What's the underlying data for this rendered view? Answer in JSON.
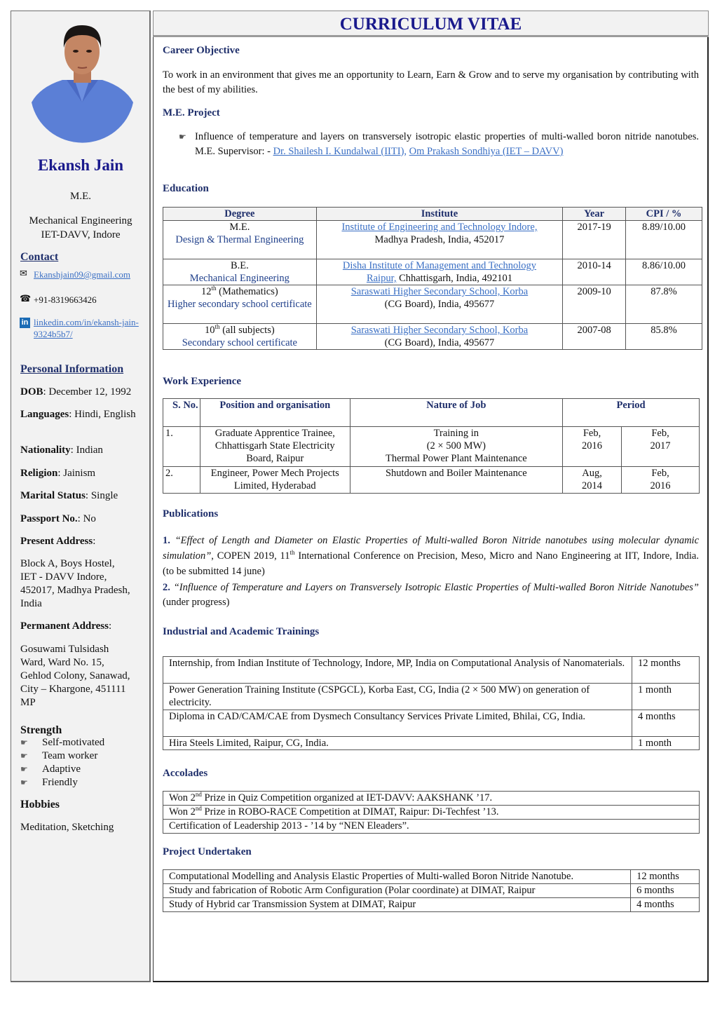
{
  "sidebar": {
    "name": "Ekansh Jain",
    "degree": "M.E.",
    "department_line1": "Mechanical Engineering",
    "department_line2": "IET-DAVV, Indore",
    "contact_heading": "Contact",
    "email": "Ekanshjain09@gmail.com",
    "phone": "+91-8319663426",
    "linkedin_line1": "linkedin.com/in/ekansh-jain-",
    "linkedin_line2": "9324b5b7/",
    "icons": {
      "email": "envelope-icon",
      "phone": "telephone-icon",
      "linkedin": "linkedin-icon",
      "bullet": "pointing-hand-icon"
    },
    "personal_heading": "Personal Information",
    "dob_label": "DOB",
    "dob_value": ": December 12, 1992",
    "languages_label": "Languages",
    "languages_value": ": Hindi, English",
    "nationality_label": "Nationality",
    "nationality_value": ": Indian",
    "religion_label": "Religion",
    "religion_value": ": Jainism",
    "marital_label": "Marital Status",
    "marital_value": ": Single",
    "passport_label": "Passport No.",
    "passport_value": ": No",
    "present_address_label": "Present Address",
    "present_address": [
      "Block A, Boys Hostel,",
      "IET - DAVV Indore,",
      "452017, Madhya Pradesh,",
      "India"
    ],
    "permanent_address_label": "Permanent Address",
    "permanent_address": [
      "Gosuwami Tulsidash",
      "Ward, Ward No. 15,",
      "Gehlod Colony, Sanawad,",
      "City – Khargone, 451111",
      "MP"
    ],
    "strength_heading": "Strength",
    "strengths": [
      "Self-motivated",
      "Team worker",
      "Adaptive",
      "Friendly"
    ],
    "hobbies_heading": "Hobbies",
    "hobbies": "Meditation, Sketching"
  },
  "main": {
    "title": "CURRICULUM VITAE",
    "career_heading": "Career Objective",
    "career_text": "To work in an environment that gives me an opportunity to Learn, Earn & Grow and to serve my organisation by contributing with the best of my abilities.",
    "project_heading": "M.E. Project",
    "project_text": "Influence of temperature and layers on transversely isotropic elastic properties of multi-walled boron nitride nanotubes. M.E. Supervisor: - ",
    "supervisor1": "Dr. Shailesh I. Kundalwal (IITI),",
    "supervisor2": "Om Prakash Sondhiya (IET – DAVV)",
    "education_heading": "Education",
    "education_headers": [
      "Degree",
      "Institute",
      "Year",
      "CPI / %"
    ],
    "education": [
      {
        "degree": "M.E.",
        "degree_sub": "Design & Thermal Engineering",
        "institute_link": "Institute of Engineering and Technology Indore,",
        "institute_rest": "Madhya Pradesh, India, 452017",
        "year": "2017-19",
        "score": "8.89/10.00"
      },
      {
        "degree": "B.E.",
        "degree_sub": "Mechanical Engineering",
        "institute_link": "Disha Institute of Management and Technology",
        "institute_link2": "Raipur,",
        "institute_rest": " Chhattisgarh, India, 492101",
        "year": "2010-14",
        "score": "8.86/10.00"
      },
      {
        "degree_num": "12",
        "degree_sup": "th",
        "degree_tail": " (Mathematics)",
        "degree_sub": "Higher secondary school certificate",
        "institute_link": "Saraswati Higher Secondary School, Korba",
        "institute_rest": "(CG Board), India, 495677",
        "year": "2009-10",
        "score": "87.8%"
      },
      {
        "degree_num": "10",
        "degree_sup": "th",
        "degree_tail": " (all subjects)",
        "degree_sub": "Secondary school certificate",
        "institute_link": "Saraswati Higher Secondary School, Korba",
        "institute_rest": "(CG Board), India, 495677",
        "year": "2007-08",
        "score": "85.8%"
      }
    ],
    "work_heading": "Work Experience",
    "work_headers": [
      "S. No.",
      "Position and organisation",
      "Nature of Job",
      "Period"
    ],
    "work": [
      {
        "sno": "1.",
        "position": "Graduate Apprentice Trainee, Chhattisgarh State Electricity Board, Raipur",
        "nature": [
          "Training in",
          "(2 × 500 MW)",
          "Thermal Power Plant Maintenance"
        ],
        "from": "Feb, 2016",
        "to": "Feb, 2017"
      },
      {
        "sno": "2.",
        "position": "Engineer, Power Mech Projects Limited, Hyderabad",
        "nature": [
          "Shutdown and Boiler Maintenance"
        ],
        "from": "Aug, 2014",
        "to": "Feb, 2016"
      }
    ],
    "publications_heading": "Publications",
    "publications": [
      {
        "num": "1.",
        "title": "“Effect of Length and Diameter on Elastic Properties of Multi-walled Boron Nitride nanotubes using molecular dynamic simulation”",
        "rest_a": ", COPEN 2019, 11",
        "rest_sup": "th",
        "rest_b": " International Conference on Precision, Meso, Micro and Nano Engineering at IIT, Indore, India. (to be submitted 14 june)"
      },
      {
        "num": "2.",
        "title": "“Influence of Temperature and Layers on Transversely Isotropic Elastic Properties of Multi-walled Boron Nitride Nanotubes”",
        "rest_a": " (under progress)"
      }
    ],
    "trainings_heading": "Industrial and Academic Trainings",
    "trainings": [
      {
        "text": "Internship, from Indian Institute of Technology, Indore, MP, India on Computational Analysis of Nanomaterials.",
        "duration": "12 months"
      },
      {
        "text": "Power Generation Training Institute (CSPGCL), Korba East, CG, India (2 × 500 MW) on generation of electricity.",
        "duration": "1 month"
      },
      {
        "text": "Diploma in CAD/CAM/CAE from Dysmech Consultancy Services Private Limited, Bhilai, CG, India.",
        "duration": "4 months"
      },
      {
        "text": "Hira Steels Limited, Raipur, CG, India.",
        "duration": "1 month"
      }
    ],
    "accolades_heading": "Accolades",
    "accolades": [
      {
        "a": "Won 2",
        "sup": "nd",
        "b": " Prize in Quiz Competition organized at IET-DAVV: AAKSHANK ’17."
      },
      {
        "a": "Won 2",
        "sup": "nd",
        "b": " Prize in ROBO-RACE Competition at DIMAT, Raipur: Di-Techfest ’13."
      },
      {
        "a": "Certification of Leadership 2013 - ’14 by “NEN Eleaders”.",
        "sup": "",
        "b": ""
      }
    ],
    "projects_heading": "Project Undertaken",
    "projects": [
      {
        "text": "Computational Modelling and Analysis Elastic Properties of Multi-walled Boron Nitride Nanotube.",
        "duration": "12 months"
      },
      {
        "text": "Study and fabrication of Robotic Arm Configuration (Polar coordinate) at DIMAT, Raipur",
        "duration": "6 months"
      },
      {
        "text": "Study of Hybrid car Transmission System at DIMAT, Raipur",
        "duration": "4 months"
      }
    ]
  }
}
